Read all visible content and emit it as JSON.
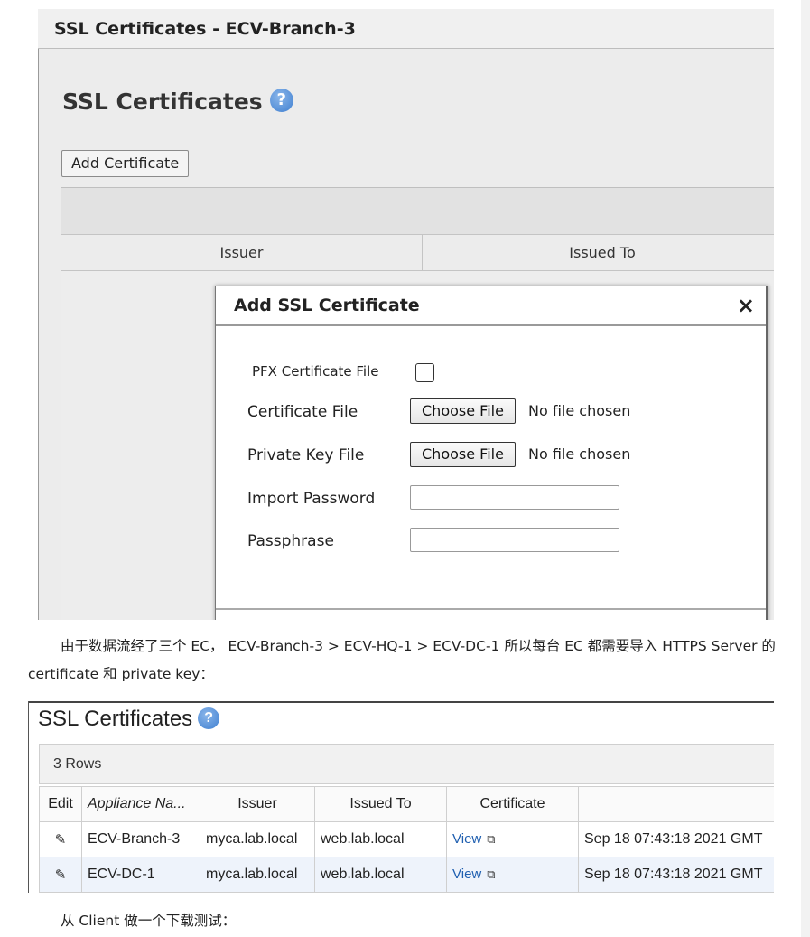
{
  "screenshot1": {
    "window_title": "SSL Certificates - ECV-Branch-3",
    "heading": "SSL Certificates",
    "help_icon": "help-icon",
    "add_button": "Add Certificate",
    "table_headers": [
      "Issuer",
      "Issued To"
    ],
    "dialog": {
      "title": "Add SSL Certificate",
      "close_glyph": "×",
      "fields": {
        "pfx_label": "PFX Certificate File",
        "cert_label": "Certificate File",
        "cert_button": "Choose File",
        "cert_status": "No file chosen",
        "key_label": "Private Key File",
        "key_button": "Choose File",
        "key_status": "No file chosen",
        "import_password_label": "Import Password",
        "passphrase_label": "Passphrase"
      }
    }
  },
  "paragraph1": "由于数据流经了三个 EC， ECV-Branch-3 > ECV-HQ-1 > ECV-DC-1 所以每台 EC 都需要导入 HTTPS Server 的 certificate 和 private key：",
  "screenshot2": {
    "heading": "SSL Certificates",
    "rows_label": "3 Rows",
    "headers": [
      "Edit",
      "Appliance Na...",
      "Issuer",
      "Issued To",
      "Certificate",
      ""
    ],
    "rows": [
      {
        "edit": "✎",
        "appliance": "ECV-Branch-3",
        "issuer": "myca.lab.local",
        "issued_to": "web.lab.local",
        "certificate": "View",
        "expires": "Sep 18 07:43:18 2021 GMT"
      },
      {
        "edit": "✎",
        "appliance": "ECV-DC-1",
        "issuer": "myca.lab.local",
        "issued_to": "web.lab.local",
        "certificate": "View",
        "expires": "Sep 18 07:43:18 2021 GMT"
      }
    ]
  },
  "paragraph2": "从 Client 做一个下载测试："
}
